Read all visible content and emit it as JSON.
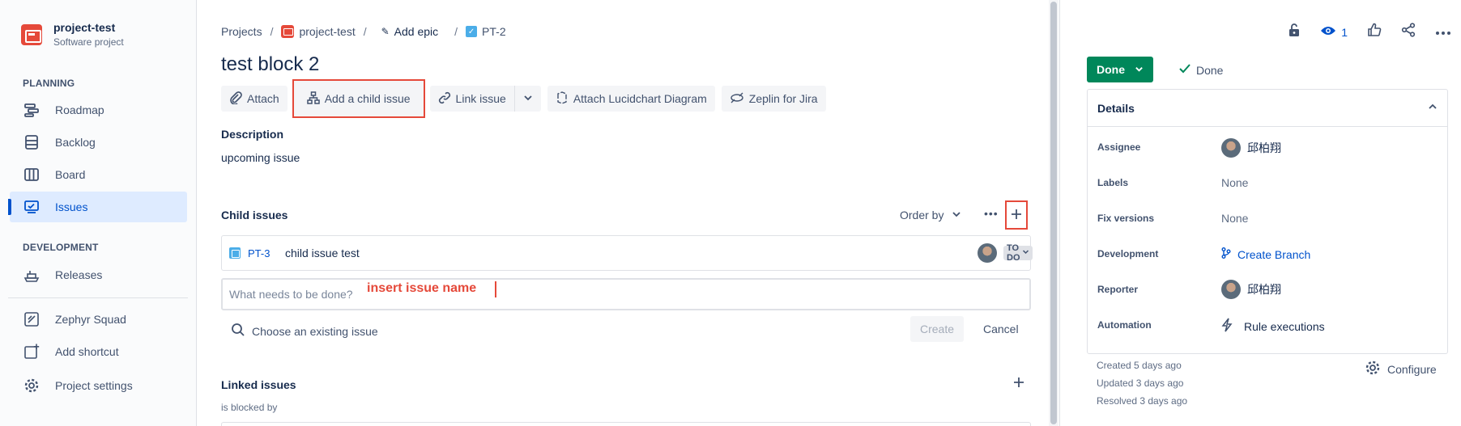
{
  "sidebar": {
    "project_name": "project-test",
    "project_type": "Software project",
    "planning_label": "PLANNING",
    "development_label": "DEVELOPMENT",
    "items": [
      {
        "label": "Roadmap",
        "icon": "roadmap-icon"
      },
      {
        "label": "Backlog",
        "icon": "backlog-icon"
      },
      {
        "label": "Board",
        "icon": "board-icon"
      },
      {
        "label": "Issues",
        "icon": "issues-icon",
        "active": true
      },
      {
        "label": "Releases",
        "icon": "releases-icon"
      },
      {
        "label": "Zephyr Squad",
        "icon": "zephyr-icon"
      },
      {
        "label": "Add shortcut",
        "icon": "add-shortcut-icon"
      },
      {
        "label": "Project settings",
        "icon": "gear-icon"
      }
    ]
  },
  "breadcrumb": {
    "projects": "Projects",
    "project": "project-test",
    "epic": "Add epic",
    "issue": "PT-2"
  },
  "issue": {
    "title": "test block 2",
    "toolbar": {
      "attach": "Attach",
      "add_child": "Add a child issue",
      "link_issue": "Link issue",
      "lucidchart": "Attach Lucidchart Diagram",
      "zeplin": "Zeplin for Jira"
    },
    "description_label": "Description",
    "description": "upcoming issue",
    "child_issues_label": "Child issues",
    "order_by": "Order by",
    "children": [
      {
        "key": "PT-3",
        "summary": "child issue test",
        "status": "TO DO"
      }
    ],
    "new_child_placeholder": "What needs to be done?",
    "annotation": "insert issue name",
    "choose_existing": "Choose an existing issue",
    "create": "Create",
    "cancel": "Cancel",
    "linked_issues_label": "Linked issues",
    "is_blocked_by": "is blocked by"
  },
  "right": {
    "watchers": "1",
    "status_button": "Done",
    "resolution": "Done",
    "details_label": "Details",
    "fields": {
      "assignee_label": "Assignee",
      "assignee": "邱柏翔",
      "labels_label": "Labels",
      "labels": "None",
      "fix_versions_label": "Fix versions",
      "fix_versions": "None",
      "development_label": "Development",
      "development": "Create Branch",
      "reporter_label": "Reporter",
      "reporter": "邱柏翔",
      "automation_label": "Automation",
      "automation": "Rule executions"
    },
    "created": "Created 5 days ago",
    "updated": "Updated 3 days ago",
    "resolved": "Resolved 3 days ago",
    "configure": "Configure"
  },
  "colors": {
    "accent": "#0052cc",
    "done_green": "#00875a",
    "annotation_red": "#e5493a"
  }
}
